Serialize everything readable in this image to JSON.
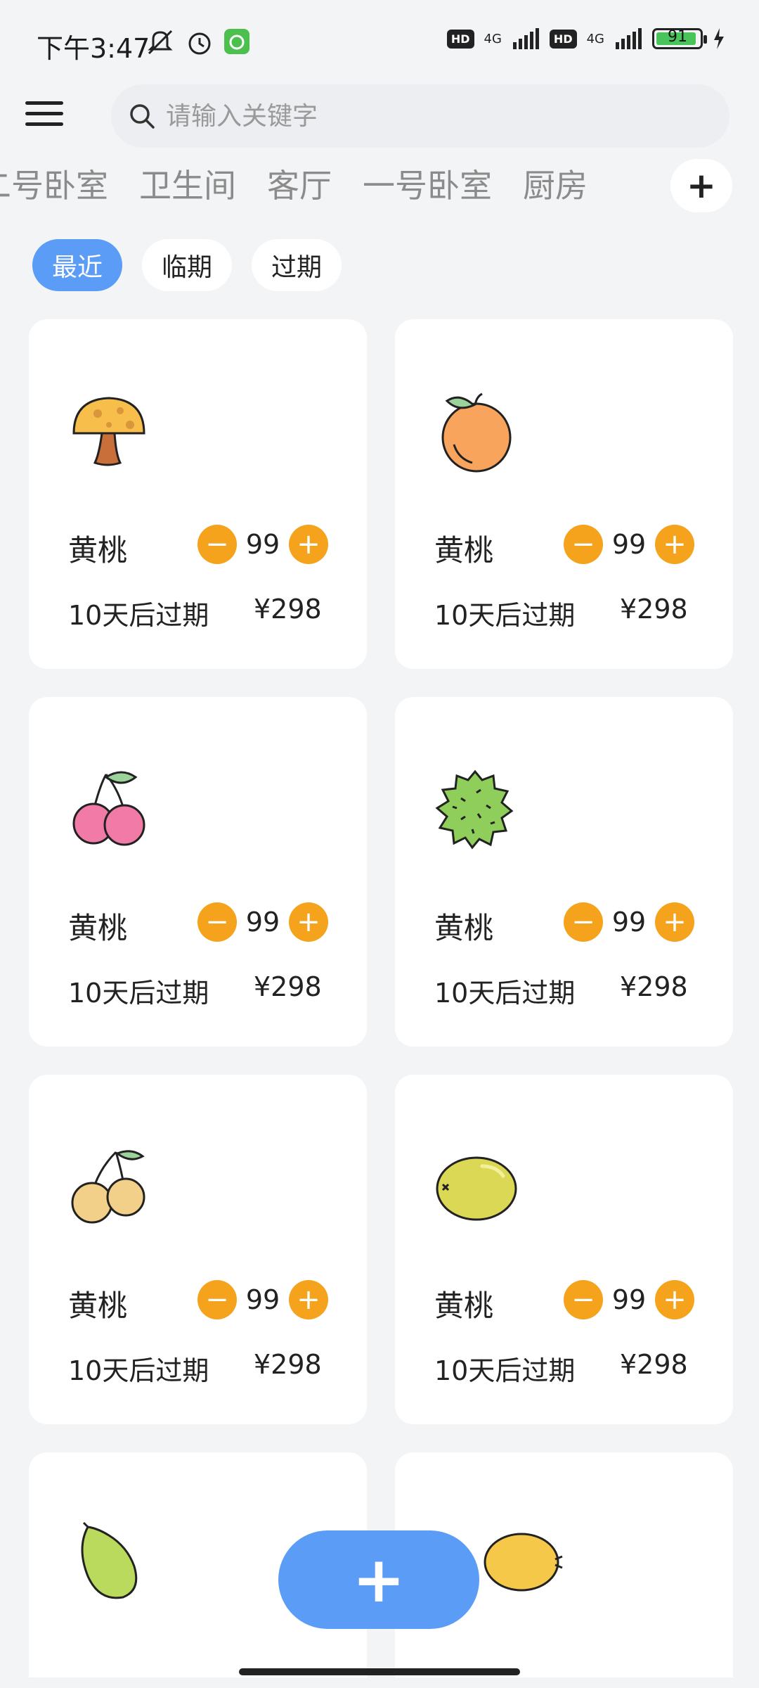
{
  "status": {
    "time": "下午3:47",
    "battery": "91",
    "net1": "4G",
    "net2": "4G",
    "hd": "HD"
  },
  "search": {
    "placeholder": "请输入关键字"
  },
  "tabs": [
    "二号卧室",
    "卫生间",
    "客厅",
    "一号卧室",
    "厨房"
  ],
  "tab_add": "+",
  "filters": [
    "最近",
    "临期",
    "过期"
  ],
  "items": [
    {
      "name": "黄桃",
      "qty": "99",
      "expiry": "10天后过期",
      "price": "¥298",
      "icon": "mushroom-icon"
    },
    {
      "name": "黄桃",
      "qty": "99",
      "expiry": "10天后过期",
      "price": "¥298",
      "icon": "orange-icon"
    },
    {
      "name": "黄桃",
      "qty": "99",
      "expiry": "10天后过期",
      "price": "¥298",
      "icon": "cherry-icon"
    },
    {
      "name": "黄桃",
      "qty": "99",
      "expiry": "10天后过期",
      "price": "¥298",
      "icon": "durian-icon"
    },
    {
      "name": "黄桃",
      "qty": "99",
      "expiry": "10天后过期",
      "price": "¥298",
      "icon": "pear-icon"
    },
    {
      "name": "黄桃",
      "qty": "99",
      "expiry": "10天后过期",
      "price": "¥298",
      "icon": "lime-icon"
    }
  ],
  "partial_items": [
    {
      "icon": "papaya-icon"
    },
    {
      "icon": "lemon-icon"
    }
  ],
  "fab": "+",
  "colors": {
    "accent": "#5b9cf6",
    "stepper": "#f5a21c",
    "background": "#f3f4f6"
  }
}
